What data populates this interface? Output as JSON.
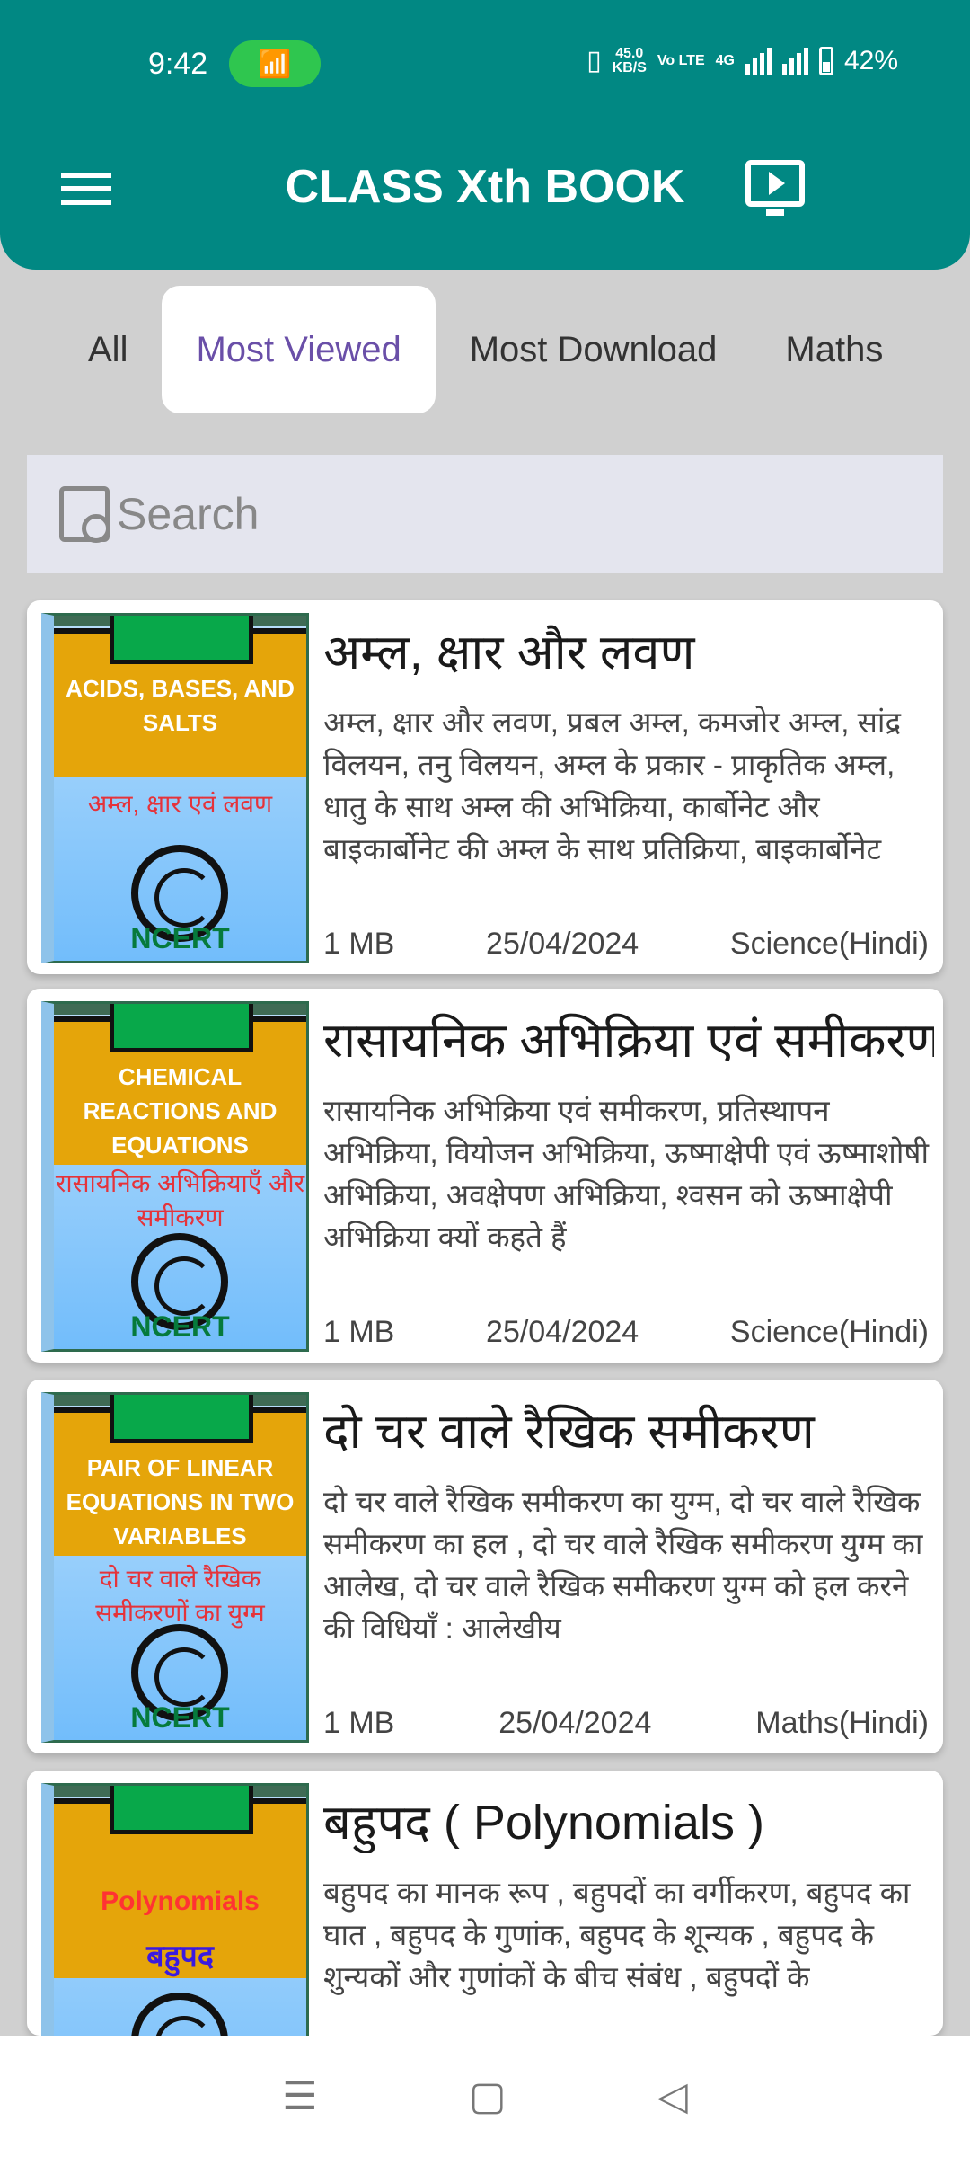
{
  "status": {
    "time": "9:42",
    "speed": "45.0",
    "speed_unit": "KB/S",
    "volte": "Vo LTE",
    "network": "4G",
    "battery": "42%"
  },
  "header": {
    "title": "CLASS Xth BOOK"
  },
  "tabs": [
    {
      "label": "All"
    },
    {
      "label": "Most Viewed",
      "active": true
    },
    {
      "label": "Most Download"
    },
    {
      "label": "Maths"
    }
  ],
  "search": {
    "placeholder": "Search"
  },
  "books": [
    {
      "title": "अम्ल, क्षार और लवण",
      "description": "अम्ल, क्षार और लवण, प्रबल अम्ल, कमजोर अम्ल, सांद्र विलयन, तनु विलयन, अम्ल के प्रकार - प्राकृतिक अम्ल, धातु के साथ अम्ल की अभिक्रिया, कार्बोनेट और बाइकार्बोनेट की अम्ल के साथ प्रतिक्रिया, बाइकार्बोनेट",
      "size": "1 MB",
      "date": "25/04/2024",
      "subject": "Science(Hindi)",
      "cover_en": "ACIDS, BASES, AND SALTS",
      "cover_hi": "अम्ल, क्षार एवं लवण",
      "cover_brand": "NCERT"
    },
    {
      "title": "रासायनिक अभिक्रिया एवं समीकरण",
      "description": "रासायनिक अभिक्रिया एवं समीकरण, प्रतिस्थापन अभिक्रिया,  वियोजन अभिक्रिया, ऊष्माक्षेपी एवं ऊष्माशोषी अभिक्रिया, अवक्षेपण अभिक्रिया, श्वसन को ऊष्माक्षेपी अभिक्रिया क्यों कहते हैं",
      "size": "1 MB",
      "date": "25/04/2024",
      "subject": "Science(Hindi)",
      "cover_en": "CHEMICAL REACTIONS AND EQUATIONS",
      "cover_hi": "रासायनिक अभिक्रियाएँ और समीकरण",
      "cover_brand": "NCERT"
    },
    {
      "title": "दो चर वाले रैखिक समीकरण",
      "description": "दो चर वाले रैखिक समीकरण का युग्म, दो चर वाले रैखिक समीकरण का हल , दो चर वाले रैखिक समीकरण युग्म का  आलेख, दो चर वाले रैखिक समीकरण युग्म को हल करने की विधियाँ : आलेखीय",
      "size": "1 MB",
      "date": "25/04/2024",
      "subject": "Maths(Hindi)",
      "cover_en": "PAIR OF LINEAR EQUATIONS IN TWO VARIABLES",
      "cover_hi": "दो चर वाले रैखिक समीकरणों का युग्म",
      "cover_brand": "NCERT"
    },
    {
      "title": "बहुपद ( Polynomials )",
      "description": "बहुपद का मानक रूप , बहुपदों का वर्गीकरण, बहुपद का घात , बहुपद के गुणांक, बहुपद के शून्यक , बहुपद के शुन्यकों और गुणांकों के बीच संबंध , बहुपदों के",
      "size": "",
      "date": "",
      "subject": "",
      "cover_en": "Polynomials",
      "cover_hi": "बहुपद",
      "cover_brand": ""
    }
  ]
}
